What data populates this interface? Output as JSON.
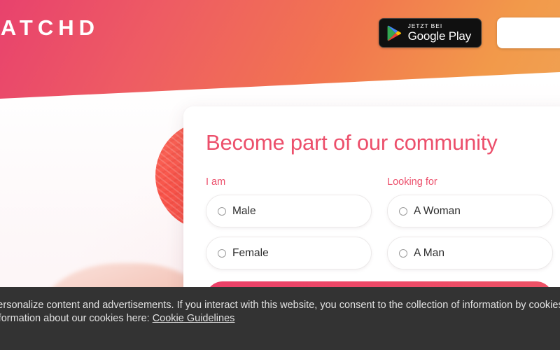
{
  "header": {
    "logo_text": "MATCHD",
    "gradient_start": "#e8426d",
    "gradient_end": "#f0a152",
    "badges": {
      "google_play": {
        "icon": "google-play-icon",
        "top_label": "JETZT BEI",
        "bottom_label": "Google Play"
      },
      "app_store": {
        "label": ""
      }
    }
  },
  "card": {
    "title": "Become part of our community",
    "accent_color": "#ec4f6b",
    "i_am": {
      "label": "I am",
      "options": [
        {
          "label": "Male",
          "selected": false
        },
        {
          "label": "Female",
          "selected": false
        }
      ]
    },
    "looking_for": {
      "label": "Looking for",
      "options": [
        {
          "label": "A Woman",
          "selected": false
        },
        {
          "label": "A Man",
          "selected": false
        }
      ]
    },
    "submit_label": ""
  },
  "cookie_banner": {
    "background_color": "#333333",
    "text_before": "We use cookies to personalize content and advertisements. If you interact with this website, you consent to the collection of information by cookies on this website. You can find more information about our cookies here: ",
    "link_label": "Cookie Guidelines"
  }
}
